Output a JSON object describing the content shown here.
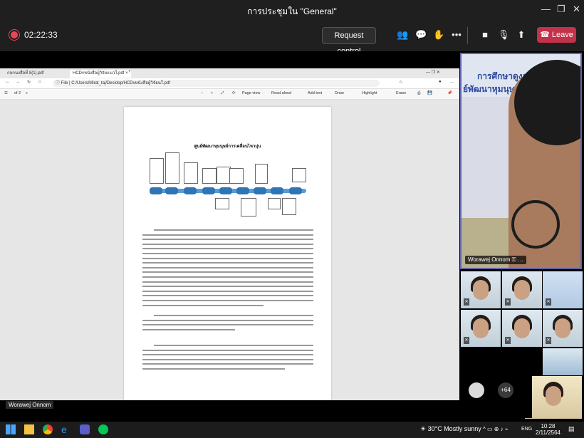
{
  "window": {
    "title": "การประชุมใน \"General\""
  },
  "meeting": {
    "timer": "02:22:33",
    "request_control": "Request control",
    "leave": "Leave"
  },
  "browser": {
    "tabs": [
      {
        "label": "กลกนงสือที่ 8(1).pdf"
      },
      {
        "label": "HCDvหนังสือผู้วิจัยแนวใ.pdf"
      }
    ],
    "address": "C:/Users/Mirat_taj/Desktop/HCDvหนังสือผู้วิจัยนใ.pdf",
    "file_label": "File",
    "pdf": {
      "page": "of 2",
      "page_view": "Page view",
      "read_aloud": "Read aloud",
      "add_text": "Add text",
      "draw": "Draw",
      "highlight": "Highlight",
      "erase": "Erase"
    },
    "doc_title": "ศูนย์พัฒนาหุมนุษย์การเคลื่อนไหวมุ่น"
  },
  "presenter": {
    "name": "Worawej Onnom"
  },
  "speaker": {
    "name": "Worawej Onnom",
    "banner_line1": "การศึกษาดูงาน",
    "banner_line2": "ย์พัฒนาหุมนุษ"
  },
  "participants_more": "+64",
  "taskbar": {
    "weather": "30°C  Mostly sunny",
    "lang": "ENG",
    "time": "10:28",
    "date": "2/11/2564"
  }
}
